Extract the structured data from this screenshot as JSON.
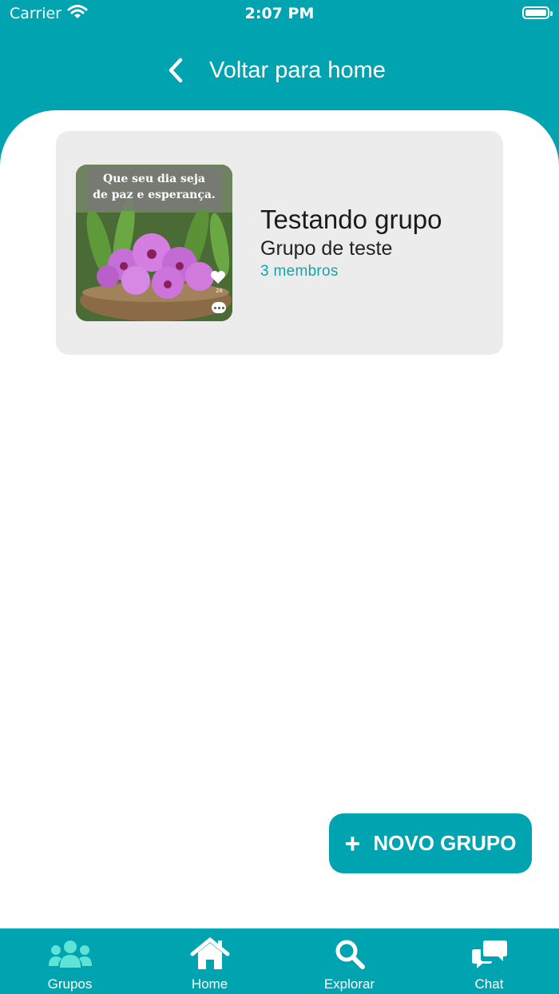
{
  "status_bar": {
    "carrier": "Carrier",
    "time": "2:07 PM"
  },
  "nav": {
    "back_label": "Voltar para home"
  },
  "group": {
    "name": "Testando grupo",
    "description": "Grupo de teste",
    "members": "3 membros",
    "image_caption_line1": "Que seu dia seja",
    "image_caption_line2": "de paz e esperança.",
    "image_likes": "28"
  },
  "fab": {
    "label": "NOVO GRUPO"
  },
  "tabs": [
    {
      "label": "Grupos",
      "icon": "users-icon",
      "active": true
    },
    {
      "label": "Home",
      "icon": "home-icon",
      "active": false
    },
    {
      "label": "Explorar",
      "icon": "search-icon",
      "active": false
    },
    {
      "label": "Chat",
      "icon": "chat-icon",
      "active": false
    }
  ],
  "colors": {
    "brand": "#00a3b0",
    "active_tab_icon": "#5fe3d6",
    "card_bg": "#ececec",
    "members_text": "#12a4ad"
  }
}
